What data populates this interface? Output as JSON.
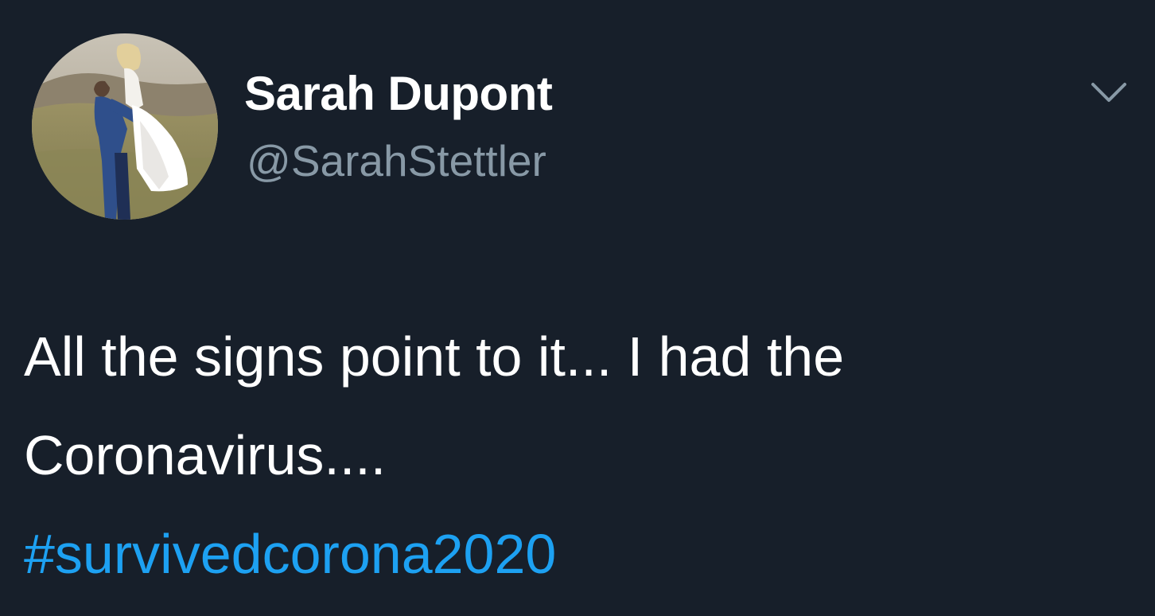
{
  "colors": {
    "background": "#171f2a",
    "primary_text": "#ffffff",
    "secondary_text": "#8899a6",
    "link": "#1da1f2"
  },
  "tweet": {
    "author": {
      "display_name": "Sarah Dupont",
      "handle": "@SarahStettler",
      "avatar_icon": "profile-photo-avatar"
    },
    "menu_icon": "chevron-down-icon",
    "text_lines": [
      "All the signs point to it... I had the",
      "Coronavirus...."
    ],
    "hashtag": "#survivedcorona2020"
  }
}
